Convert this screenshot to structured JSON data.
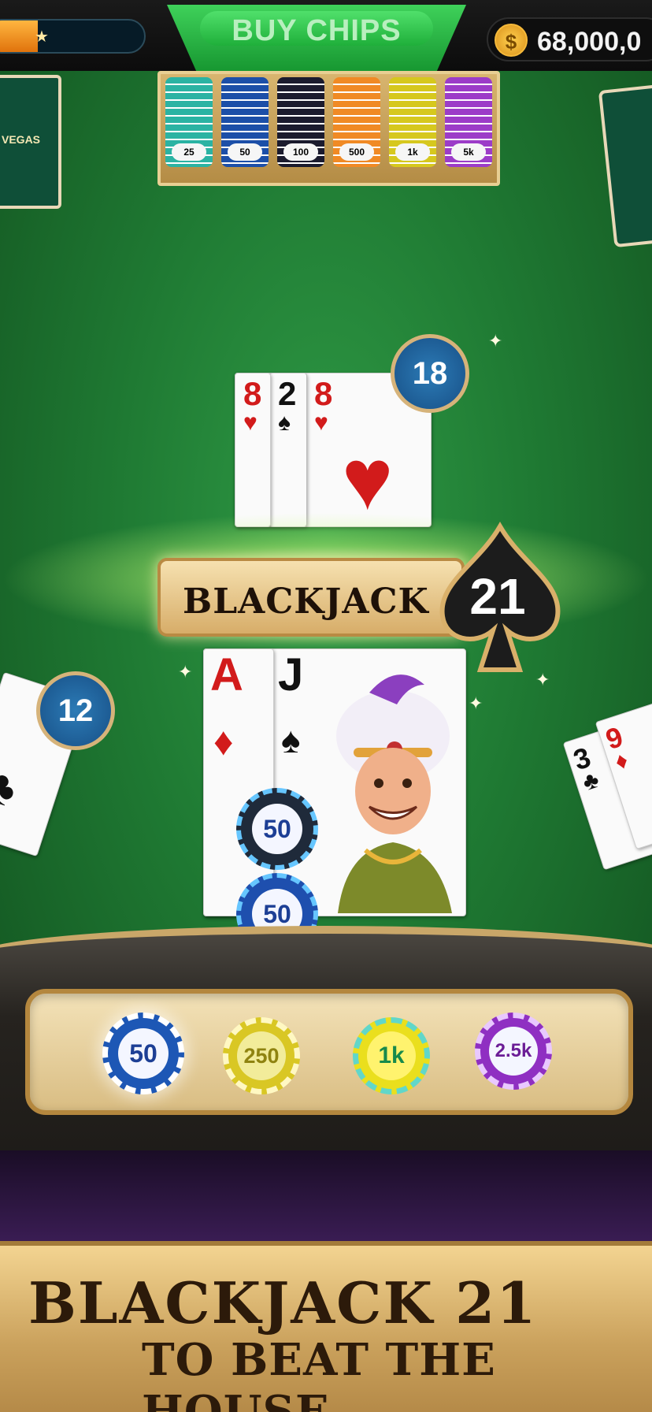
{
  "top_bar": {
    "buy_chips_label": "BUY CHIPS",
    "coin_symbol": "$",
    "coin_balance": "68,000,0",
    "xp_progress": 0.33
  },
  "chip_rack": [
    {
      "value": "25",
      "color": "#2bb3a3"
    },
    {
      "value": "50",
      "color": "#1c4fa8"
    },
    {
      "value": "100",
      "color": "#1b1b2e"
    },
    {
      "value": "500",
      "color": "#f08a25"
    },
    {
      "value": "1k",
      "color": "#d6c81e"
    },
    {
      "value": "5k",
      "color": "#9c3cc8"
    }
  ],
  "side_deck_label": "VEGAS",
  "dealer_hand": {
    "cards": [
      {
        "rank": "8",
        "suit": "♥",
        "color": "red"
      },
      {
        "rank": "2",
        "suit": "♠",
        "color": "black"
      },
      {
        "rank": "8",
        "suit": "♥",
        "color": "red"
      }
    ],
    "score": "18"
  },
  "player_hand": {
    "cards": [
      {
        "rank": "A",
        "suit": "♦",
        "color": "red"
      },
      {
        "rank": "J",
        "suit": "♠",
        "color": "black"
      }
    ],
    "bet_chips": [
      "50",
      "50"
    ]
  },
  "left_seat": {
    "score": "12",
    "suit": "♣"
  },
  "right_seat": {
    "cards": [
      {
        "rank": "3",
        "suit": "♣",
        "color": "black"
      },
      {
        "rank": "9",
        "suit": "♦",
        "color": "red"
      }
    ]
  },
  "banner": {
    "label": "BLACKJACK",
    "number": "21"
  },
  "chip_tray": [
    {
      "value": "50",
      "color": "#1d57b5"
    },
    {
      "value": "250",
      "color": "#d9c724"
    },
    {
      "value": "1k",
      "color": "#e6de1e"
    },
    {
      "value": "2.5k",
      "color": "#8f2fc2"
    }
  ],
  "promo": {
    "line1": "BLACKJACK 21",
    "line2": "TO BEAT THE HOUSE"
  },
  "colors": {
    "felt": "#1f7a33",
    "gold": "#c9a769",
    "badge_blue": "#1f5f99"
  }
}
